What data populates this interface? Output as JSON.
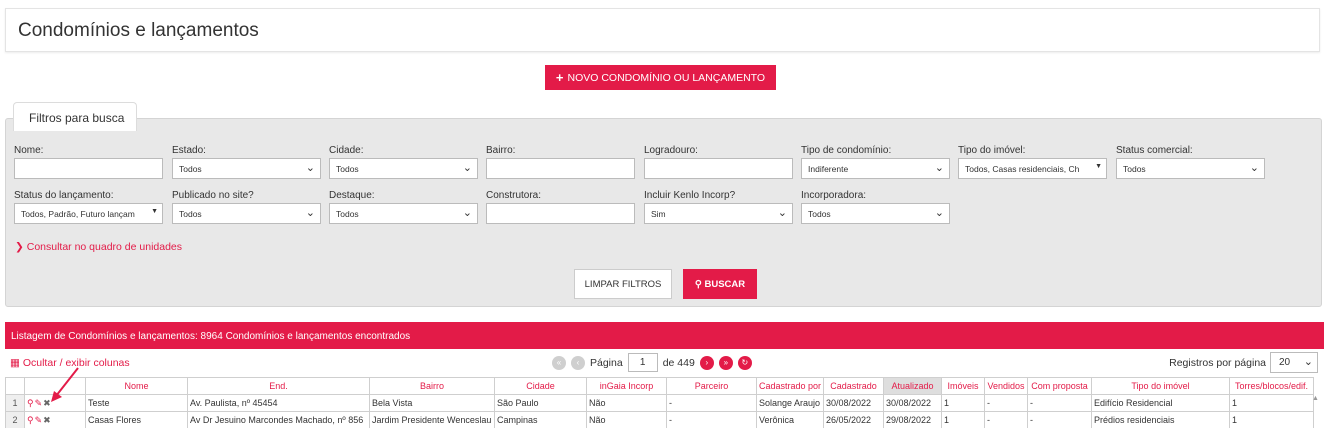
{
  "header": {
    "title": "Condomínios e lançamentos"
  },
  "actions": {
    "new_label": "NOVO CONDOMÍNIO OU LANÇAMENTO",
    "plus_icon": "+"
  },
  "filters": {
    "tab_label": "Filtros para busca",
    "nome": {
      "label": "Nome:",
      "value": ""
    },
    "estado": {
      "label": "Estado:",
      "value": "Todos"
    },
    "cidade": {
      "label": "Cidade:",
      "value": "Todos"
    },
    "bairro": {
      "label": "Bairro:",
      "value": ""
    },
    "logradouro": {
      "label": "Logradouro:",
      "value": ""
    },
    "tipo_condominio": {
      "label": "Tipo de condomínio:",
      "value": "Indiferente"
    },
    "tipo_imovel": {
      "label": "Tipo do imóvel:",
      "value": "Todos, Casas residenciais, Ch"
    },
    "status_comercial": {
      "label": "Status comercial:",
      "value": "Todos"
    },
    "status_lancamento": {
      "label": "Status do lançamento:",
      "value": "Todos, Padrão, Futuro lançam"
    },
    "publicado": {
      "label": "Publicado no site?",
      "value": "Todos"
    },
    "destaque": {
      "label": "Destaque:",
      "value": "Todos"
    },
    "construtora": {
      "label": "Construtora:",
      "value": ""
    },
    "kenlo": {
      "label": "Incluir Kenlo Incorp?",
      "value": "Sim"
    },
    "incorporadora": {
      "label": "Incorporadora:",
      "value": "Todos"
    },
    "consult_link": "Consultar no quadro de unidades",
    "clear_label": "LIMPAR FILTROS",
    "search_label": "BUSCAR"
  },
  "listing": {
    "header": "Listagem de Condomínios e lançamentos: 8964 Condomínios e lançamentos encontrados",
    "toggle_columns": "Ocultar / exibir colunas",
    "page_label": "Página",
    "page_value": "1",
    "page_total": "de 449",
    "per_page_label": "Registros por página",
    "per_page_value": "20",
    "columns": [
      "Nome",
      "End.",
      "Bairro",
      "Cidade",
      "inGaia Incorp",
      "Parceiro",
      "Cadastrado por",
      "Cadastrado",
      "Atualizado",
      "Imóveis",
      "Vendidos",
      "Com proposta",
      "Tipo do imóvel",
      "Torres/blocos/edif."
    ],
    "rows": [
      {
        "num": "1",
        "nome": "Teste",
        "end": "Av. Paulista, nº 45454",
        "bairro": "Bela Vista",
        "cidade": "São Paulo",
        "incorp": "Não",
        "parceiro": "-",
        "cadastrado_por": "Solange Araujo",
        "cadastrado": "30/08/2022",
        "atualizado": "30/08/2022",
        "imoveis": "1",
        "vendidos": "-",
        "proposta": "-",
        "tipo": "Edifício Residencial",
        "torres": "1"
      },
      {
        "num": "2",
        "nome": "Casas Flores",
        "end": "Av Dr Jesuino Marcondes Machado, nº 856",
        "bairro": "Jardim Presidente Wenceslau",
        "cidade": "Campinas",
        "incorp": "Não",
        "parceiro": "-",
        "cadastrado_por": "Verônica",
        "cadastrado": "26/05/2022",
        "atualizado": "29/08/2022",
        "imoveis": "1",
        "vendidos": "-",
        "proposta": "-",
        "tipo": "Prédios residenciais",
        "torres": "1"
      }
    ]
  },
  "icons": {
    "search": "search-icon",
    "edit": "edit-icon",
    "delete": "close-icon"
  },
  "colors": {
    "accent": "#e31b48",
    "panel": "#e8e8e8"
  }
}
